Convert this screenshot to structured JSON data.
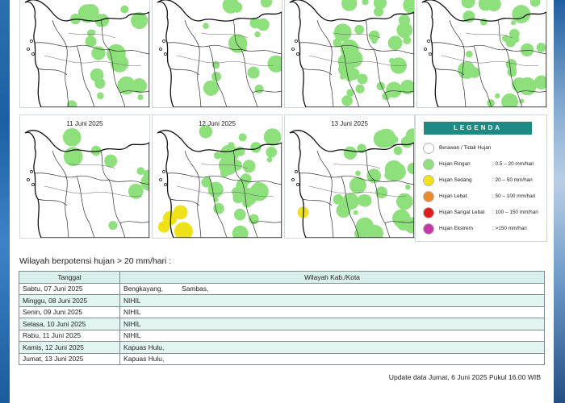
{
  "colors": {
    "map_rain_light": "#8ee07c",
    "map_rain_moderate": "#f0e21a",
    "legend_header": "#1e8a84",
    "table_row_alt": "#e2f5f2"
  },
  "maps": [
    {
      "title": "",
      "rain_light": 0.35,
      "rain_moderate": 0.0
    },
    {
      "title": "",
      "rain_light": 0.25,
      "rain_moderate": 0.0
    },
    {
      "title": "",
      "rain_light": 0.55,
      "rain_moderate": 0.0
    },
    {
      "title": "",
      "rain_light": 0.45,
      "rain_moderate": 0.0
    },
    {
      "title": "11 Juni 2025",
      "rain_light": 0.15,
      "rain_moderate": 0.0
    },
    {
      "title": "12 Juni 2025",
      "rain_light": 0.55,
      "rain_moderate": 0.1
    },
    {
      "title": "13 Juni 2025",
      "rain_light": 0.6,
      "rain_moderate": 0.02
    }
  ],
  "legend": {
    "title": "LEGENDA",
    "items": [
      {
        "name": "Berawan / Tidak Hujan",
        "range": "",
        "color": "#ffffff"
      },
      {
        "name": "Hujan Ringan",
        "range": ": 0.5 – 20 mm/hari",
        "color": "#8ee07c"
      },
      {
        "name": "Hujan Sedang",
        "range": ": 20 – 50 mm/hari",
        "color": "#f0e21a"
      },
      {
        "name": "Hujan Lebat",
        "range": ": 50 – 100 mm/hari",
        "color": "#e98b2a"
      },
      {
        "name": "Hujan Sangat Lebat",
        "range": ": 100 – 150 mm/hari",
        "color": "#e01b1b"
      },
      {
        "name": "Hujan Ekstrem",
        "range": ": >150 mm/hari",
        "color": "#c23aa6"
      }
    ]
  },
  "table": {
    "title": "Wilayah berpotensi hujan > 20 mm/hari :",
    "headers": [
      "Tanggal",
      "Wilayah Kab./Kota"
    ],
    "rows": [
      {
        "date": "Sabtu, 07 Juni 2025",
        "region": "Bengkayang,          Sambas,"
      },
      {
        "date": "Minggu, 08 Juni 2025",
        "region": "NIHIL"
      },
      {
        "date": "Senin, 09 Juni 2025",
        "region": "NIHIL"
      },
      {
        "date": "Selasa, 10 Juni 2025",
        "region": "NIHIL"
      },
      {
        "date": "Rabu, 11 Juni 2025",
        "region": "NIHIL"
      },
      {
        "date": "Kamis, 12 Juni 2025",
        "region": "Kapuas Hulu,"
      },
      {
        "date": "Jumat, 13 Juni 2025",
        "region": "Kapuas Hulu,"
      }
    ]
  },
  "update_text": "Update data Jumat, 6 Juni 2025 Pukul 16.00 WIB"
}
